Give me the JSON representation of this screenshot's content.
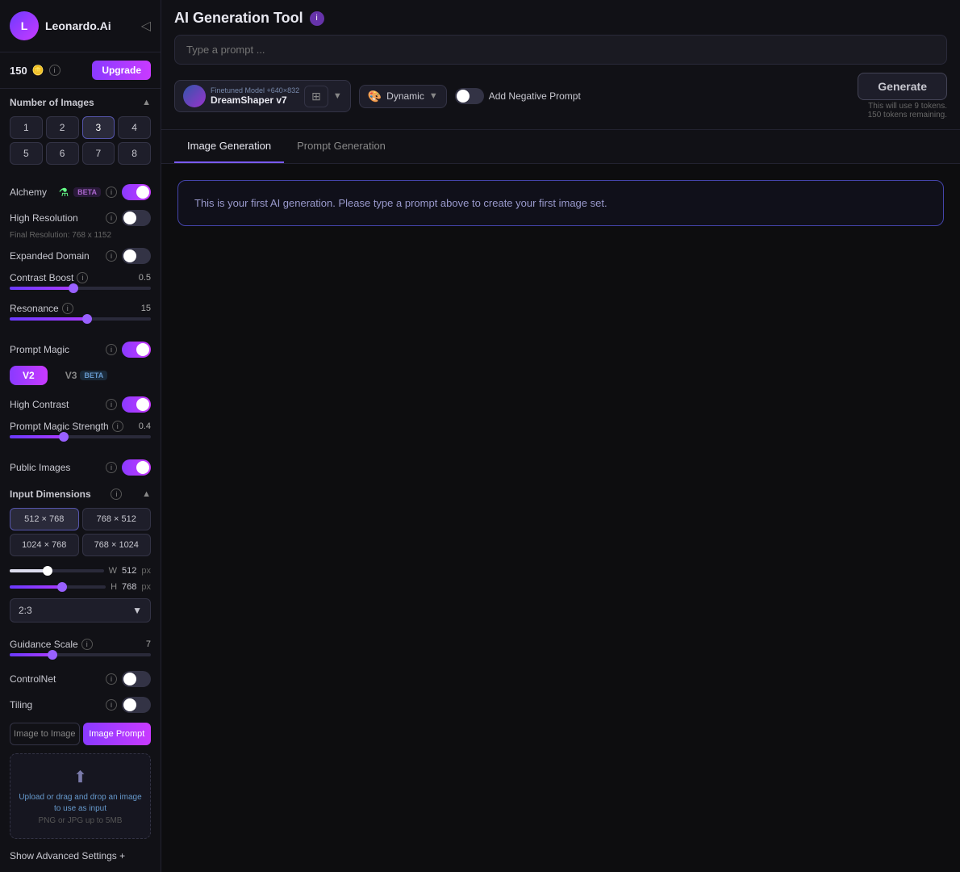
{
  "app": {
    "title": "AI Generation Tool",
    "logo_text": "Leonardo.Ai"
  },
  "sidebar": {
    "token_count": "150",
    "upgrade_label": "Upgrade",
    "sections": {
      "number_of_images": {
        "label": "Number of Images",
        "options": [
          "1",
          "2",
          "3",
          "4",
          "5",
          "6",
          "7",
          "8"
        ],
        "selected": "3"
      },
      "alchemy": {
        "label": "Alchemy",
        "badge": "BETA",
        "enabled": true
      },
      "high_resolution": {
        "label": "High Resolution",
        "enabled": false,
        "sub_label": "Final Resolution: 768 x 1152"
      },
      "expanded_domain": {
        "label": "Expanded Domain",
        "enabled": false
      },
      "contrast_boost": {
        "label": "Contrast Boost",
        "value": "0.5",
        "fill_pct": 45
      },
      "resonance": {
        "label": "Resonance",
        "value": "15",
        "fill_pct": 55
      },
      "prompt_magic": {
        "label": "Prompt Magic",
        "enabled": true,
        "versions": [
          "V2",
          "V3"
        ],
        "active_version": "V2",
        "v3_badge": "BETA"
      },
      "high_contrast": {
        "label": "High Contrast",
        "enabled": true
      },
      "prompt_magic_strength": {
        "label": "Prompt Magic Strength",
        "value": "0.4",
        "fill_pct": 38
      },
      "public_images": {
        "label": "Public Images",
        "enabled": true
      },
      "input_dimensions": {
        "label": "Input Dimensions",
        "presets": [
          "512 × 768",
          "768 × 512",
          "1024 × 768",
          "768 × 1024"
        ],
        "active_preset": "512 × 768",
        "width": "512",
        "height": "768",
        "unit": "px",
        "aspect_ratio": "2:3"
      },
      "guidance_scale": {
        "label": "Guidance Scale",
        "value": "7",
        "fill_pct": 30
      },
      "controlnet": {
        "label": "ControlNet",
        "enabled": false
      },
      "tiling": {
        "label": "Tiling",
        "enabled": false
      }
    },
    "image_tabs": {
      "image_to_image": "Image to Image",
      "image_prompt": "Image Prompt",
      "active": "Image Prompt"
    },
    "upload": {
      "icon": "⬆",
      "text_link": "Upload or drag and drop",
      "text_rest": " an image to use as input",
      "sub": "PNG or JPG up to 5MB"
    },
    "show_advanced": "Show Advanced Settings +"
  },
  "toolbar": {
    "prompt_placeholder": "Type a prompt ...",
    "model": {
      "tag": "Finetuned Model  +640×832",
      "name": "DreamShaper v7"
    },
    "style": {
      "icon": "🎨",
      "label": "Dynamic"
    },
    "neg_prompt_toggle": "Add Negative Prompt",
    "generate_label": "Generate",
    "token_info_line1": "This will use 9 tokens.",
    "token_info_line2": "150 tokens remaining."
  },
  "tabs": {
    "image_generation": "Image Generation",
    "prompt_generation": "Prompt Generation",
    "active": "Image Generation"
  },
  "main_content": {
    "first_gen_message": "This is your first AI generation. Please type a prompt above to create your first image set."
  }
}
